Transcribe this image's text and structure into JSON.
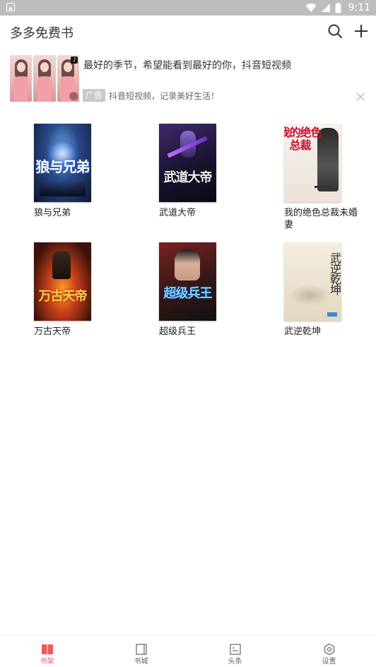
{
  "status_bar": {
    "time": "9:11"
  },
  "app_bar": {
    "title": "多多免费书",
    "search_icon": "search-icon",
    "add_icon": "plus-icon"
  },
  "ad": {
    "headline": "最好的季节，希望能看到最好的你，抖音短视频",
    "badge": "广告",
    "subtitle": "抖音短视频，记录美好生活！",
    "close_icon": "close-icon"
  },
  "books": [
    {
      "title": "狼与兄弟",
      "cover_text": "狼与兄弟",
      "cover_color": "#1a2a5a"
    },
    {
      "title": "武道大帝",
      "cover_text": "武道大帝",
      "cover_color": "#2a1a3a"
    },
    {
      "title": "我的绝色总裁未婚妻",
      "cover_text": "我的绝色总裁",
      "cover_color": "#f2ece6"
    },
    {
      "title": "万古天帝",
      "cover_text": "万古天帝",
      "cover_color": "#5a1e0e"
    },
    {
      "title": "超级兵王",
      "cover_text": "超级兵王",
      "cover_color": "#3a1e1e"
    },
    {
      "title": "武逆乾坤",
      "cover_text": "武逆乾坤",
      "cover_color": "#efe6d6"
    }
  ],
  "bottom_nav": [
    {
      "label": "书架",
      "icon": "bookshelf-icon",
      "active": true
    },
    {
      "label": "书城",
      "icon": "bookstore-icon",
      "active": false
    },
    {
      "label": "头条",
      "icon": "headlines-icon",
      "active": false
    },
    {
      "label": "设置",
      "icon": "settings-icon",
      "active": false
    }
  ],
  "colors": {
    "accent": "#f05a5a",
    "status_bar": "#bdbdbd"
  }
}
